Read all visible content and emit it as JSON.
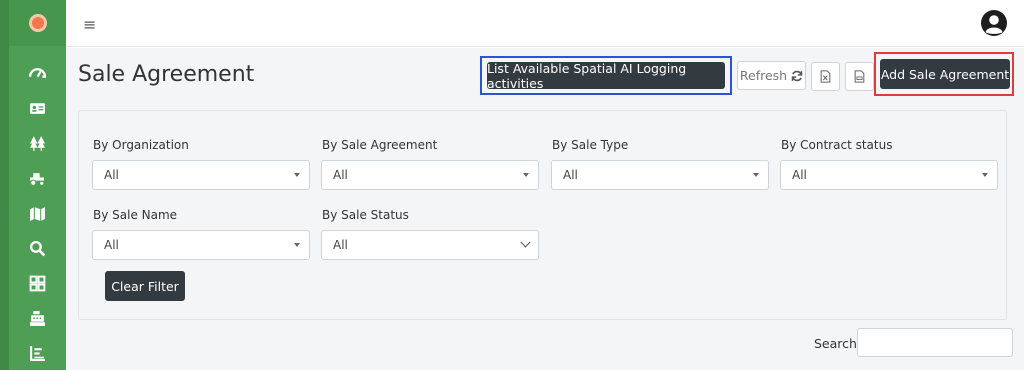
{
  "sidebar": {
    "icons": [
      "dashboard-icon",
      "id-card-icon",
      "trees-icon",
      "tractor-icon",
      "map-icon",
      "search-icon",
      "grid-icon",
      "cash-register-icon",
      "chart-icon"
    ]
  },
  "header": {
    "menu_icon": "≡"
  },
  "page": {
    "title": "Sale Agreement",
    "buttons": {
      "list_activities": "List Available Spatial AI Logging activities",
      "refresh": "Refresh",
      "add": "Add Sale Agreement",
      "clear_filter": "Clear Filter"
    }
  },
  "filters": [
    {
      "label": "By Organization",
      "value": "All"
    },
    {
      "label": "By Sale Agreement",
      "value": "All"
    },
    {
      "label": "By Sale Type",
      "value": "All"
    },
    {
      "label": "By Contract status",
      "value": "All"
    },
    {
      "label": "By Sale Name",
      "value": "All"
    },
    {
      "label": "By Sale Status",
      "value": "All"
    }
  ],
  "search": {
    "label": "Search:",
    "value": ""
  },
  "colors": {
    "sidebar": "#4f9e56",
    "dark_button": "#333a40",
    "highlight_blue": "#2d52d6",
    "highlight_red": "#e03a3a"
  }
}
